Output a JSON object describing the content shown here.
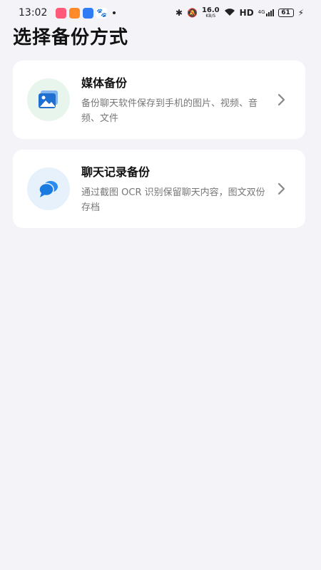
{
  "status_bar": {
    "time": "13:02",
    "net_speed_value": "16.0",
    "net_speed_unit": "KB/S",
    "hd_label": "HD",
    "network_label": "4G",
    "battery_level": "61"
  },
  "page": {
    "title": "选择备份方式"
  },
  "options": [
    {
      "title": "媒体备份",
      "description": "备份聊天软件保存到手机的图片、视频、音频、文件",
      "icon": "image-icon"
    },
    {
      "title": "聊天记录备份",
      "description": "通过截图 OCR 识别保留聊天内容，图文双份存档",
      "icon": "chat-bubbles-icon"
    }
  ],
  "colors": {
    "background": "#f3f3f8",
    "card": "#ffffff",
    "media_icon": "#1f6fd1",
    "media_icon_bg": "#e8f5ec",
    "chat_icon": "#2b8cf0",
    "chat_icon_bg": "#e6f1fc"
  }
}
